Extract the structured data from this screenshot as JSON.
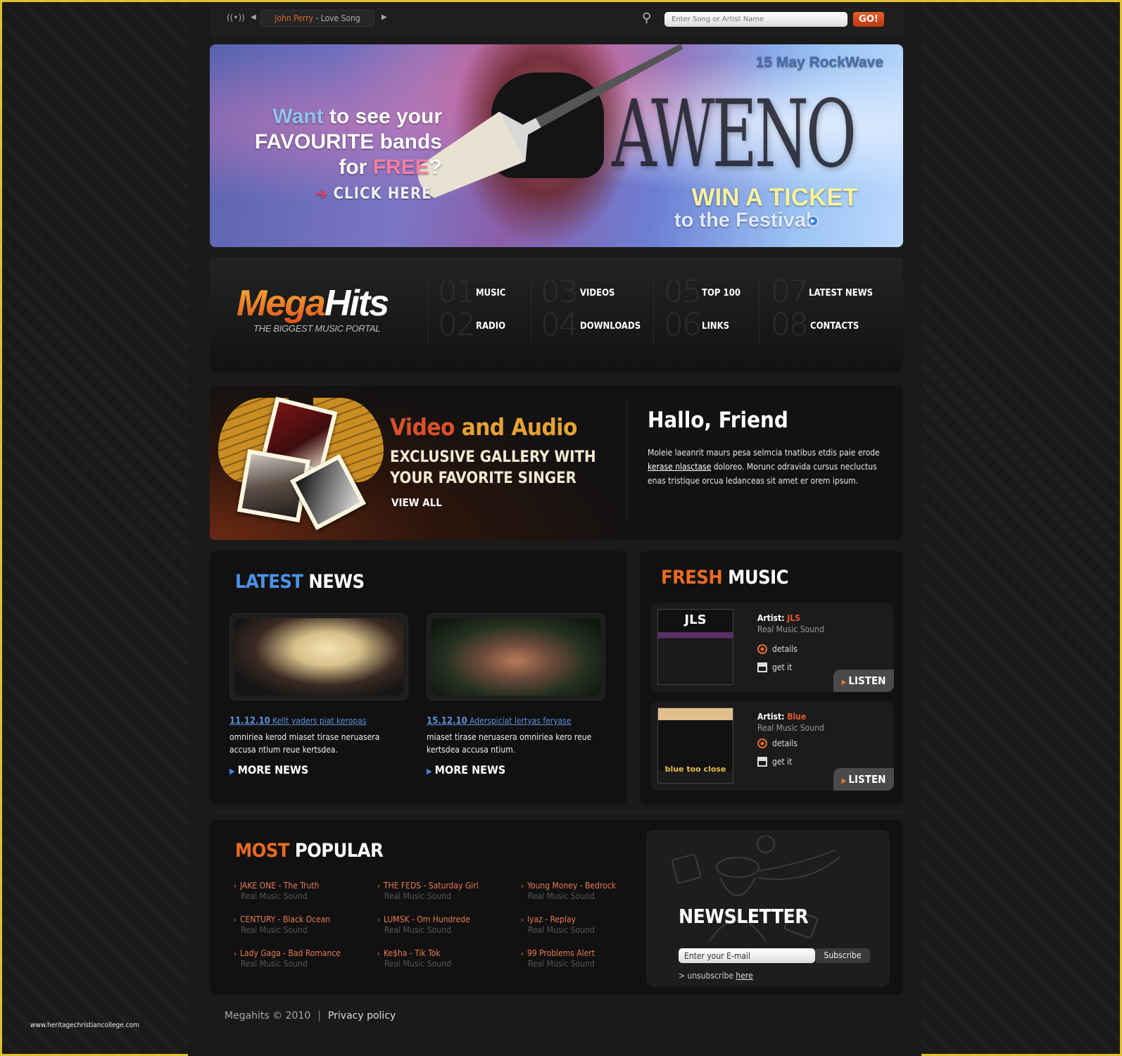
{
  "topbar": {
    "player": {
      "artist": "John Perry",
      "separator": " - ",
      "song": "Love Song",
      "icons": [
        "broadcast-icon",
        "prev-icon",
        "next-icon"
      ]
    },
    "search": {
      "placeholder": "Enter Song or Artist Name",
      "button_label": "GO!",
      "icon": "search-icon"
    }
  },
  "banner": {
    "question": {
      "word1": "Want",
      "line1_rest": " to see your",
      "line2": "FAVOURITE bands",
      "line3_pre": "for ",
      "line3_free": "FREE",
      "line3_post": "?"
    },
    "click_label": "CLICK HERE",
    "event_date": "15 May RockWave",
    "band_name": "AWENO",
    "win_label": "WIN A TICKET",
    "festival_label": "to the Festival"
  },
  "brand": {
    "logo_part1": "Mega",
    "logo_part2": "Hits",
    "tagline": "THE BIGGEST MUSIC PORTAL"
  },
  "nav": [
    {
      "num": "01",
      "label": "MUSIC"
    },
    {
      "num": "02",
      "label": "RADIO"
    },
    {
      "num": "03",
      "label": "VIDEOS"
    },
    {
      "num": "04",
      "label": "DOWNLOADS"
    },
    {
      "num": "05",
      "label": "TOP 100"
    },
    {
      "num": "06",
      "label": "LINKS"
    },
    {
      "num": "07",
      "label": "LATEST NEWS"
    },
    {
      "num": "08",
      "label": "CONTACTS"
    }
  ],
  "promo": {
    "title_part1": "Video",
    "title_part2": " and Audio",
    "subtitle_line1": "EXCLUSIVE GALLERY WITH",
    "subtitle_line2": "YOUR FAVORITE SINGER",
    "view_all": "VIEW ALL"
  },
  "welcome": {
    "title": "Hallo, Friend",
    "text_before": "Moleie laeanrit maurs pesa selmcia tnatibus etdis paie erode ",
    "link": "kerase nlasctase",
    "text_after": " doloreo. Morunc odravida cursus necluctus enas tristique orcua ledanceas sit amet er orem ipsum."
  },
  "latest_news": {
    "title_accent": "LATEST",
    "title_rest": " NEWS",
    "items": [
      {
        "date": "11.12.10",
        "headline": "Kellt yaders piat keropas",
        "text": "omniriea kerod miaset tirase neruasera accusa ntium reue kertsdea.",
        "more": "MORE NEWS"
      },
      {
        "date": "15.12.10",
        "headline": "Aderspiciat lertyas feryase",
        "text": "miaset tirase neruasera omniriea kero reue kertsdea accusa ntium.",
        "more": "MORE NEWS"
      }
    ]
  },
  "fresh_music": {
    "title_accent": "FRESH",
    "title_rest": " MUSIC",
    "artist_label": "Artist: ",
    "tracks": [
      {
        "artist": "JLS",
        "subtitle": "Real Music Sound",
        "details": "details",
        "get": "get it",
        "listen": "LISTEN",
        "cover_text": "JLS"
      },
      {
        "artist": "Blue",
        "subtitle": "Real Music Sound",
        "details": "details",
        "get": "get it",
        "listen": "LISTEN",
        "cover_text": "blue too close"
      }
    ]
  },
  "most_popular": {
    "title_accent": "MOST",
    "title_rest": " POPULAR",
    "items": [
      {
        "title": "JAKE ONE - The Truth",
        "sub": "Real Music Sound"
      },
      {
        "title": "CENTURY - Black Ocean",
        "sub": "Real Music Sound"
      },
      {
        "title": "Lady Gaga - Bad Romance",
        "sub": "Real Music Sound"
      },
      {
        "title": "THE FEDS - Saturday Girl",
        "sub": "Real Music Sound"
      },
      {
        "title": "LUMSK - Om Hundrede",
        "sub": "Real Music Sound"
      },
      {
        "title": "Ke$ha - Tik Tok",
        "sub": "Real Music Sound"
      },
      {
        "title": "Young Money - Bedrock",
        "sub": "Real Music Sound"
      },
      {
        "title": "Iyaz - Replay",
        "sub": "Real Music Sound"
      },
      {
        "title": "99 Problems Alert",
        "sub": "Real Music Sound"
      }
    ]
  },
  "newsletter": {
    "title": "NEWSLETTER",
    "input_value": "Enter your E-mail",
    "button": "Subscribe",
    "unsub_prefix": "> unsubscribe ",
    "unsub_link": "here"
  },
  "footer": {
    "copyright": "Megahits © 2010",
    "separator": "|",
    "privacy": "Privacy policy"
  },
  "watermark": "www.heritagechristiancollege.com",
  "colors": {
    "accent_orange": "#e4572a",
    "accent_blue": "#4a92e6",
    "frame_yellow": "#e2c12a",
    "background": "#1b1b1b"
  }
}
